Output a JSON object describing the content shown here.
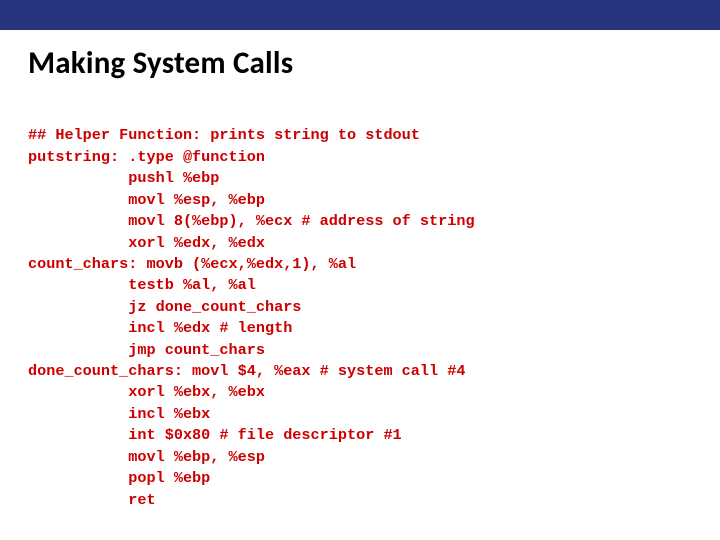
{
  "title": "Making System Calls",
  "code": {
    "l01": "## Helper Function: prints string to stdout",
    "l02": "putstring: .type @function",
    "l03": "           pushl %ebp",
    "l04": "           movl %esp, %ebp",
    "l05": "           movl 8(%ebp), %ecx # address of string",
    "l06": "           xorl %edx, %edx",
    "l07": "count_chars: movb (%ecx,%edx,1), %al",
    "l08": "           testb %al, %al",
    "l09": "           jz done_count_chars",
    "l10": "           incl %edx # length",
    "l11": "           jmp count_chars",
    "l12": "done_count_chars: movl $4, %eax # system call #4",
    "l13": "           xorl %ebx, %ebx",
    "l14": "           incl %ebx",
    "l15": "           int $0x80 # file descriptor #1",
    "l16": "           movl %ebp, %esp",
    "l17": "           popl %ebp",
    "l18": "           ret"
  }
}
